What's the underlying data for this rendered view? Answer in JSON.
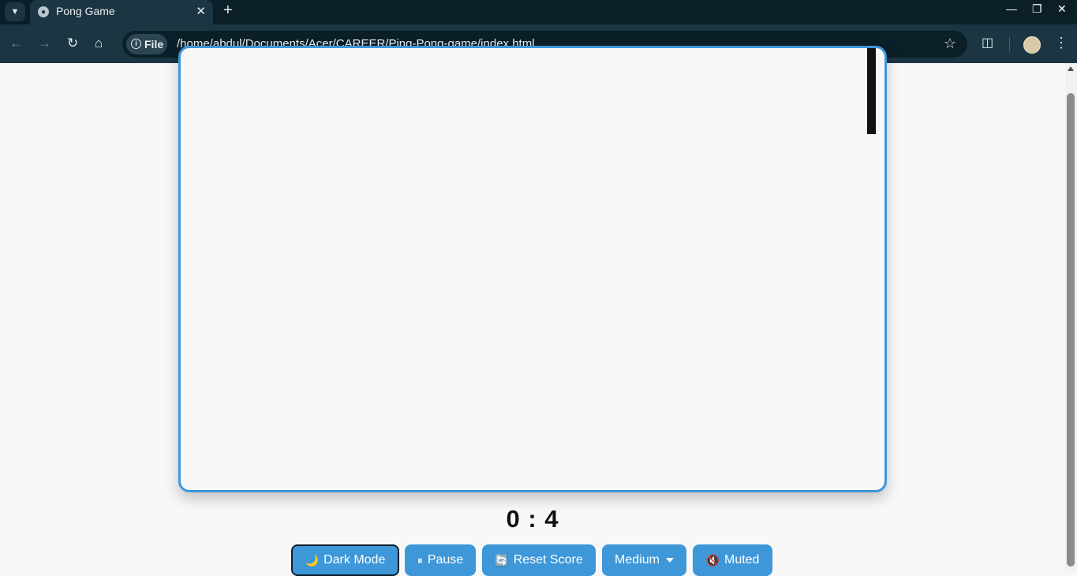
{
  "browser": {
    "tab_title": "Pong Game",
    "url_chip_label": "File",
    "url": "/home/abdul/Documents/Acer/CAREER/Ping-Pong-game/index.html",
    "accent_color": "#1c3542"
  },
  "game": {
    "score": "0 : 4",
    "canvas_border_color": "#3d97d8"
  },
  "controls": {
    "dark_mode": {
      "icon": "🌙",
      "label": "Dark Mode"
    },
    "pause": {
      "icon": "⏸",
      "label": "Pause"
    },
    "reset": {
      "icon": "🔄",
      "label": "Reset Score"
    },
    "difficulty": {
      "label": "Medium"
    },
    "sound": {
      "icon": "🔇",
      "label": "Muted"
    },
    "button_color": "#3d97d8"
  }
}
